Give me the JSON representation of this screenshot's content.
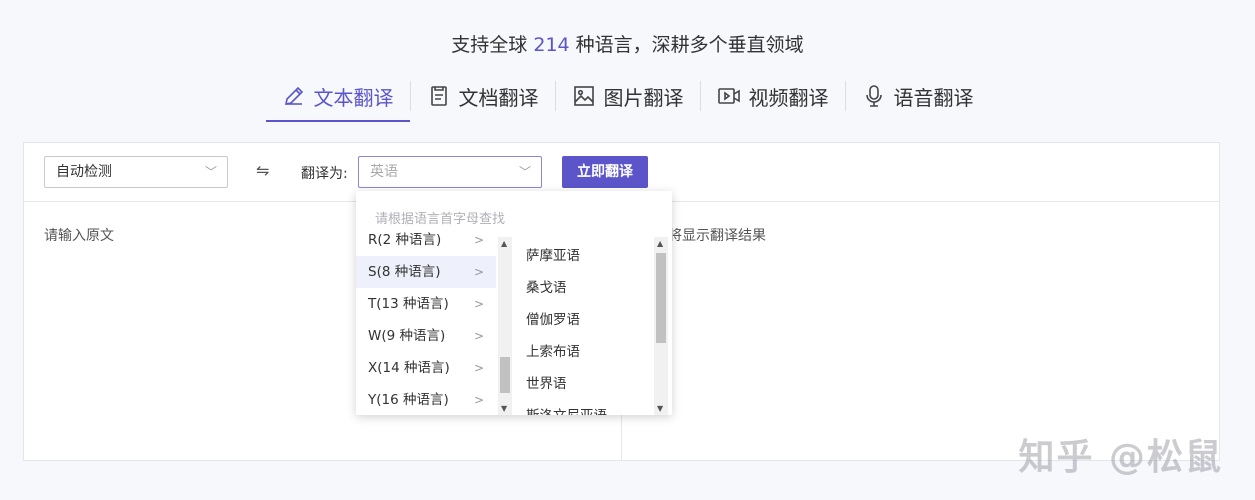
{
  "headline": {
    "prefix": "支持全球",
    "count": "214",
    "suffix": "种语言，深耕多个垂直领域"
  },
  "tabs": [
    {
      "label": "文本翻译",
      "icon": "pencil-icon",
      "active": true
    },
    {
      "label": "文档翻译",
      "icon": "document-icon",
      "active": false
    },
    {
      "label": "图片翻译",
      "icon": "image-icon",
      "active": false
    },
    {
      "label": "视频翻译",
      "icon": "video-icon",
      "active": false
    },
    {
      "label": "语音翻译",
      "icon": "microphone-icon",
      "active": false
    }
  ],
  "toolbar": {
    "source_lang": "自动检测",
    "swap_icon": "⇋",
    "target_label": "翻译为:",
    "target_lang_placeholder": "英语",
    "translate_button": "立即翻译"
  },
  "source_placeholder": "请输入原文",
  "result_placeholder": "将显示翻译结果",
  "dropdown": {
    "search_placeholder": "请根据语言首字母查找",
    "letters": [
      {
        "label": "R(2 种语言)",
        "selected": false
      },
      {
        "label": "S(8 种语言)",
        "selected": true
      },
      {
        "label": "T(13 种语言)",
        "selected": false
      },
      {
        "label": "W(9 种语言)",
        "selected": false
      },
      {
        "label": "X(14 种语言)",
        "selected": false
      },
      {
        "label": "Y(16 种语言)",
        "selected": false
      }
    ],
    "languages": [
      "萨摩亚语",
      "桑戈语",
      "僧伽罗语",
      "上索布语",
      "世界语",
      "斯洛文尼亚语"
    ]
  },
  "watermark": "知乎 @松鼠",
  "colors": {
    "accent": "#5b55c9"
  }
}
